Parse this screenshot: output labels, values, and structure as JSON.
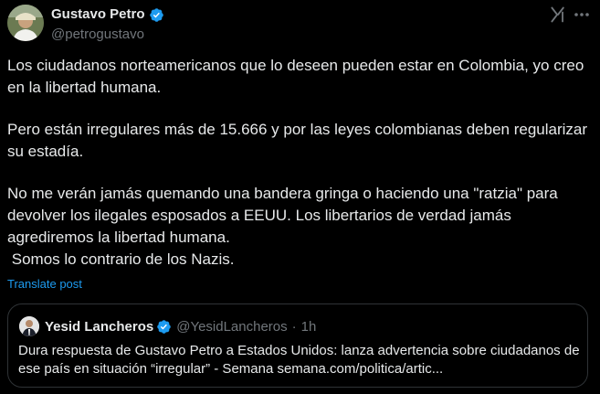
{
  "post": {
    "author": {
      "display_name": "Gustavo Petro",
      "handle": "@petrogustavo"
    },
    "paragraphs": [
      "Los ciudadanos norteamericanos que lo deseen pueden estar en Colombia, yo creo en la libertad humana.",
      "Pero están irregulares más de 15.666 y por las leyes colombianas deben regularizar su estadía.",
      "No me verán jamás quemando una bandera gringa o haciendo una \"ratzia\" para devolver los ilegales esposados a EEUU. Los libertarios de verdad jamás agrediremos la libertad humana.\n Somos lo contrario de los Nazis."
    ],
    "translate_label": "Translate post"
  },
  "quote": {
    "display_name": "Yesid Lancheros",
    "handle": "@YesidLancheros",
    "separator": "·",
    "time": "1h",
    "text": "Dura respuesta de Gustavo Petro a Estados Unidos: lanza advertencia sobre ciudadanos de ese país en situación “irregular” - Semana semana.com/politica/artic..."
  },
  "icons": {
    "verified": "verified-badge-icon",
    "grok": "grok-icon",
    "more": "more-options-icon"
  },
  "colors": {
    "background": "#000000",
    "text": "#e7e9ea",
    "secondary": "#71767b",
    "accent": "#1d9bf0",
    "border": "#2f3336"
  }
}
